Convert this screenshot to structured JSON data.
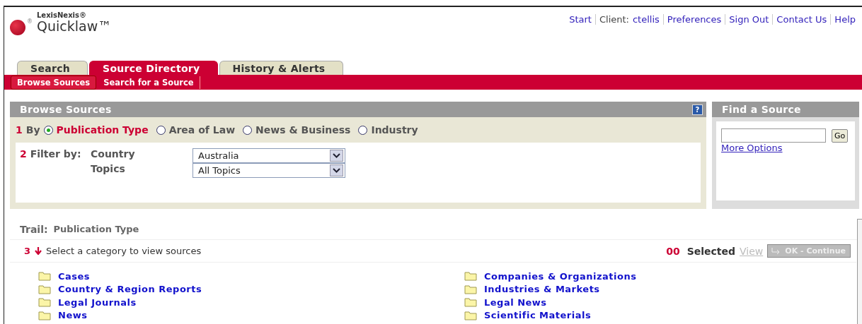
{
  "logo": {
    "mark": "®",
    "brand": "LexisNexis®",
    "product": "Quicklaw™"
  },
  "top_links": [
    {
      "label": "Start",
      "kind": "link"
    },
    {
      "label": "Client:",
      "kind": "label"
    },
    {
      "label": "ctellis",
      "kind": "link"
    },
    {
      "label": "Preferences",
      "kind": "link"
    },
    {
      "label": "Sign Out",
      "kind": "link"
    },
    {
      "label": "Contact Us",
      "kind": "link"
    },
    {
      "label": "Help",
      "kind": "link"
    }
  ],
  "tabs": [
    {
      "label": "Search",
      "selected": false
    },
    {
      "label": "Source Directory",
      "selected": true
    },
    {
      "label": "History & Alerts",
      "selected": false
    }
  ],
  "subtabs": [
    {
      "label": "Browse Sources",
      "selected": true
    },
    {
      "label": "Search for a Source",
      "selected": false
    }
  ],
  "browse": {
    "title": "Browse Sources",
    "help": "?",
    "step1": "1",
    "by": "By",
    "options": [
      {
        "label": "Publication Type",
        "selected": true
      },
      {
        "label": "Area of Law",
        "selected": false
      },
      {
        "label": "News & Business",
        "selected": false
      },
      {
        "label": "Industry",
        "selected": false
      }
    ],
    "step2": "2",
    "filter_label": "Filter by:",
    "filters": [
      {
        "label": "Country",
        "value": "Australia"
      },
      {
        "label": "Topics",
        "value": "All Topics"
      }
    ]
  },
  "find": {
    "title": "Find a Source",
    "button": "Go",
    "link": "More Options"
  },
  "trail": {
    "label": "Trail:",
    "value": "Publication Type"
  },
  "step3": "3",
  "instruction": "Select a category to view sources",
  "count": "00",
  "selected_label": "Selected",
  "view": "View",
  "continue": "OK - Continue",
  "categories": [
    [
      "Cases",
      "Country & Region Reports",
      "Legal Journals",
      "News"
    ],
    [
      "Companies & Organizations",
      "Industries & Markets",
      "Legal News",
      "Scientific Materials"
    ]
  ]
}
